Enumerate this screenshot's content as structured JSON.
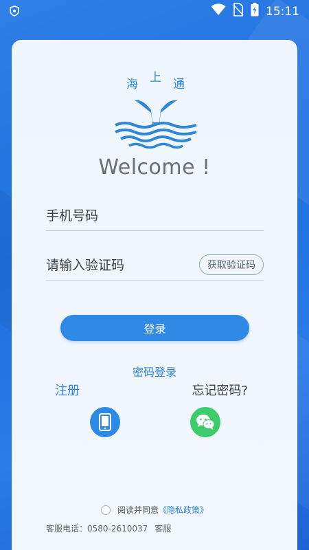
{
  "status_bar": {
    "time": "15:11",
    "icons": [
      "shield-icon",
      "wifi-icon",
      "no-sim-icon",
      "battery-charging-icon"
    ]
  },
  "logo": {
    "char1": "海",
    "char2": "上",
    "char3": "通"
  },
  "welcome": "Welcome !",
  "form": {
    "phone_placeholder": "手机号码",
    "code_placeholder": "请输入验证码",
    "get_code_label": "获取验证码",
    "login_label": "登录"
  },
  "links": {
    "password_login": "密码登录",
    "register": "注册",
    "forgot_password": "忘记密码?"
  },
  "footer": {
    "agree_text": "阅读并同意",
    "policy_text": "《隐私政策》",
    "service_phone": "客服电话：0580-2610037",
    "service_more": "客服"
  },
  "colors": {
    "primary": "#2f8ae6",
    "wechat": "#3ecb6b",
    "background": "#1f6fe0"
  }
}
